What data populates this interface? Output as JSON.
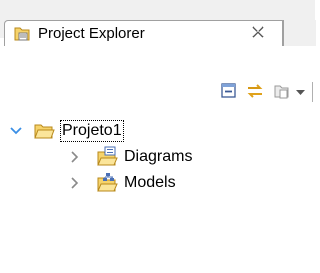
{
  "view": {
    "title": "Project Explorer",
    "close_glyph": "✗",
    "icon": "project-explorer-icon"
  },
  "toolbar": {
    "buttons": [
      {
        "name": "collapse-all-icon"
      },
      {
        "name": "link-with-editor-icon"
      },
      {
        "name": "new-icon"
      },
      {
        "name": "view-menu-chevron-icon"
      }
    ]
  },
  "tree": {
    "root": {
      "label": "Projeto1",
      "expanded": true,
      "icon": "open-folder-icon"
    },
    "children": [
      {
        "label": "Diagrams",
        "expanded": false,
        "icon": "diagrams-folder-icon"
      },
      {
        "label": "Models",
        "expanded": false,
        "icon": "models-folder-icon"
      }
    ]
  },
  "colors": {
    "tab_border": "#a0a0a0",
    "expand_arrow": "#3a8ee6",
    "collapsed_arrow": "#8a8a8a",
    "folder_yellow": "#f3c94b"
  }
}
